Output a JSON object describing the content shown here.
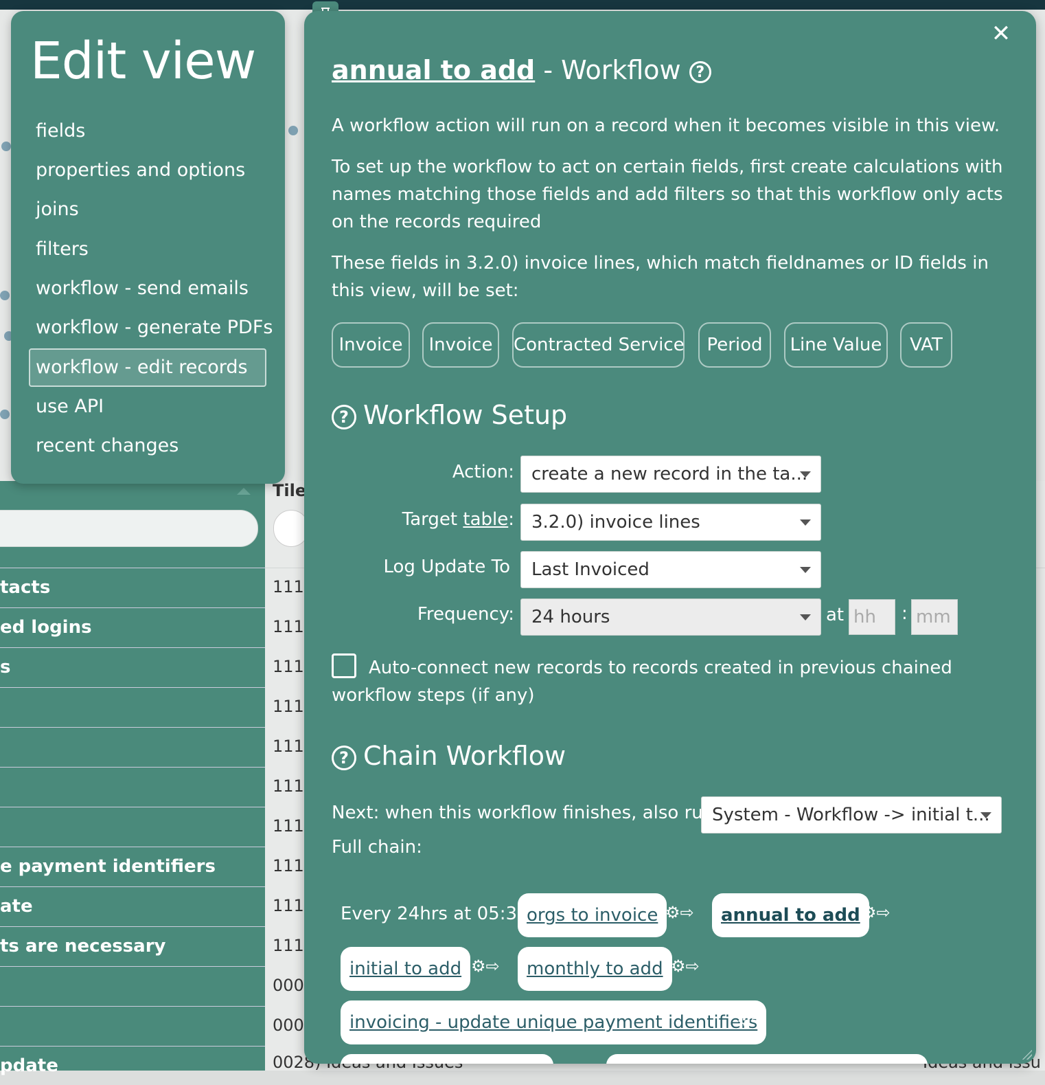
{
  "background": {
    "tile_header": "Tile",
    "left_rows": [
      "tacts",
      "ed logins",
      "s",
      "",
      "",
      "",
      "",
      "e payment identifiers",
      "ate",
      "ts are necessary",
      "",
      "",
      "pdate"
    ],
    "row_numbers": [
      "111",
      "111",
      "111",
      "111",
      "111",
      "111",
      "111",
      "111",
      "111",
      "111",
      "000",
      "000"
    ],
    "bottom_row": {
      "num": "0028) Ideas and Issues",
      "right": "Ideas and Issu"
    }
  },
  "edit_menu": {
    "title": "Edit view",
    "items": [
      {
        "label": "fields",
        "active": false
      },
      {
        "label": "properties and options",
        "active": false
      },
      {
        "label": "joins",
        "active": false
      },
      {
        "label": "filters",
        "active": false
      },
      {
        "label": "workflow - send emails",
        "active": false
      },
      {
        "label": "workflow - generate PDFs",
        "active": false
      },
      {
        "label": "workflow - edit records",
        "active": true
      },
      {
        "label": "use API",
        "active": false
      },
      {
        "label": "recent changes",
        "active": false
      }
    ]
  },
  "modal": {
    "close_symbol": "✕",
    "title_name": "annual to add",
    "title_suffix": " - Workflow",
    "help_symbol": "?",
    "intro": "A workflow action will run on a record when it becomes visible in this view.",
    "setup_instructions": "To set up the workflow to act on certain fields, first create calculations with names matching those fields and add filters so that this workflow only acts on the records required",
    "fields_intro": "These fields in 3.2.0) invoice lines, which match fieldnames or ID fields in this view, will be set:",
    "field_pills": [
      "Invoice",
      "Invoice",
      "Contracted Service",
      "Period",
      "Line Value",
      "VAT"
    ],
    "setup": {
      "heading": "Workflow Setup",
      "action_label": "Action:",
      "action_value": "create a new record in the ta...",
      "target_label_pre": "Target ",
      "target_label_link": "table",
      "target_label_post": ":",
      "target_value": "3.2.0) invoice lines",
      "log_label": "Log Update To",
      "log_value": "Last Invoiced",
      "frequency_label": "Frequency:",
      "frequency_value": "24 hours",
      "at_label": "at",
      "hh_placeholder": "hh",
      "colon": ":",
      "mm_placeholder": "mm",
      "auto_connect_label": "Auto-connect new records to records created in previous chained workflow steps (if any)"
    },
    "chain": {
      "heading": "Chain Workflow",
      "next_label": "Next: when this workflow finishes, also run",
      "next_value": "System - Workflow -> initial t...",
      "full_chain_label": "Full chain:",
      "schedule": "Every 24hrs at 05:37 :",
      "gear_arrow": "⚙⇨",
      "steps": [
        "orgs to invoice",
        "annual to add",
        "initial to add",
        "monthly to add",
        "invoicing - update unique payment identifiers"
      ]
    }
  }
}
